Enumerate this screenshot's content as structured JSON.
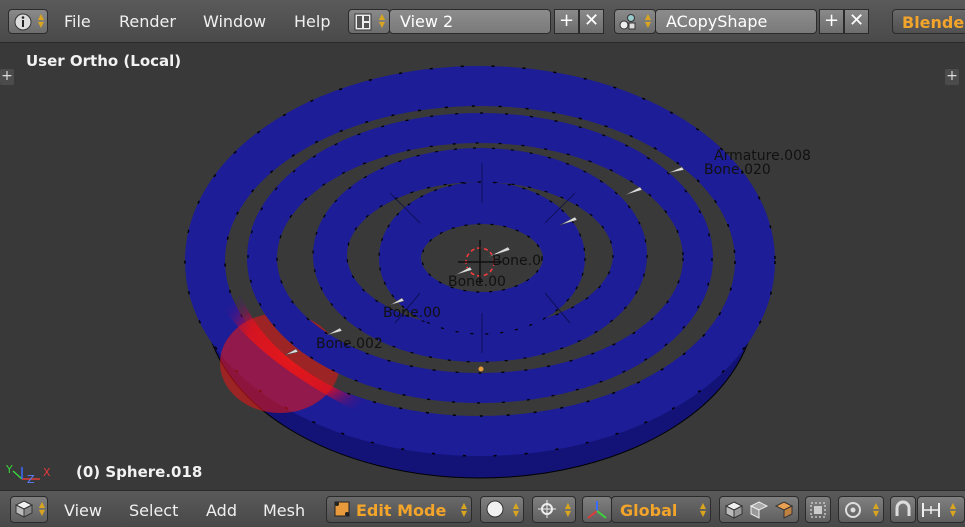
{
  "header": {
    "menu": [
      "File",
      "Render",
      "Window",
      "Help"
    ],
    "screen_layout": "View 2",
    "scene": "ACopyShape",
    "engine": "Blender"
  },
  "viewport": {
    "view_label": "User Ortho (Local)",
    "object_label": "(0) Sphere.018",
    "overlay_labels": [
      "Armature.008",
      "Bone.020",
      "Bone.0",
      "Bone.00",
      "Bone.00",
      "Bone.002"
    ]
  },
  "footer": {
    "menu": [
      "View",
      "Select",
      "Add",
      "Mesh"
    ],
    "mode": "Edit Mode",
    "orientation": "Global"
  },
  "colors": {
    "mesh_blue": "#1a1a8c",
    "mesh_weight_red": "#d01020",
    "accent_orange": "#f3a42a",
    "viewport_bg": "#393939"
  }
}
